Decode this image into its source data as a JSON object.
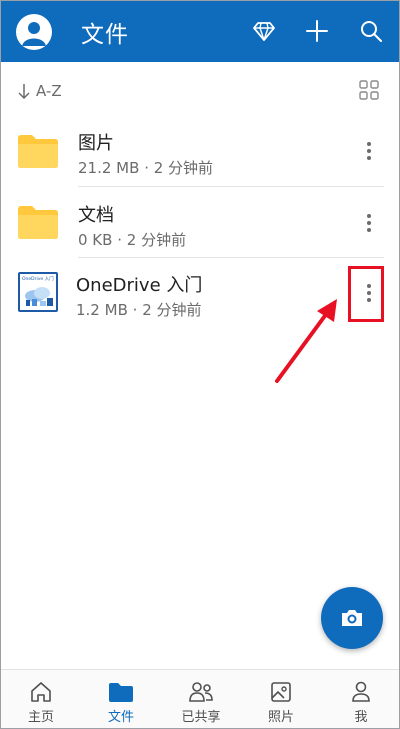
{
  "header": {
    "title": "文件",
    "icons": [
      "avatar-icon",
      "diamond-icon",
      "plus-icon",
      "search-icon"
    ]
  },
  "sort": {
    "label": "A-Z",
    "icon": "arrow-down-icon",
    "view_icon": "grid-view-icon"
  },
  "files": [
    {
      "name": "图片",
      "size": "21.2 MB",
      "time": "2 分钟前",
      "icon": "folder-icon"
    },
    {
      "name": "文档",
      "size": "0 KB",
      "time": "2 分钟前",
      "icon": "folder-icon"
    },
    {
      "name": "OneDrive 入门",
      "size": "1.2 MB",
      "time": "2 分钟前",
      "icon": "document-thumbnail",
      "thumb_text": "OneDrive 入门"
    }
  ],
  "meta_separator": "·",
  "fab": {
    "icon": "camera-icon"
  },
  "tabs": [
    {
      "label": "主页",
      "icon": "home-icon",
      "active": false
    },
    {
      "label": "文件",
      "icon": "folder-icon",
      "active": true
    },
    {
      "label": "已共享",
      "icon": "people-icon",
      "active": false
    },
    {
      "label": "照片",
      "icon": "photo-icon",
      "active": false
    },
    {
      "label": "我",
      "icon": "person-icon",
      "active": false
    }
  ],
  "colors": {
    "accent": "#0f6cbd",
    "folder": "#ffc83d",
    "annotation": "#e81123"
  }
}
